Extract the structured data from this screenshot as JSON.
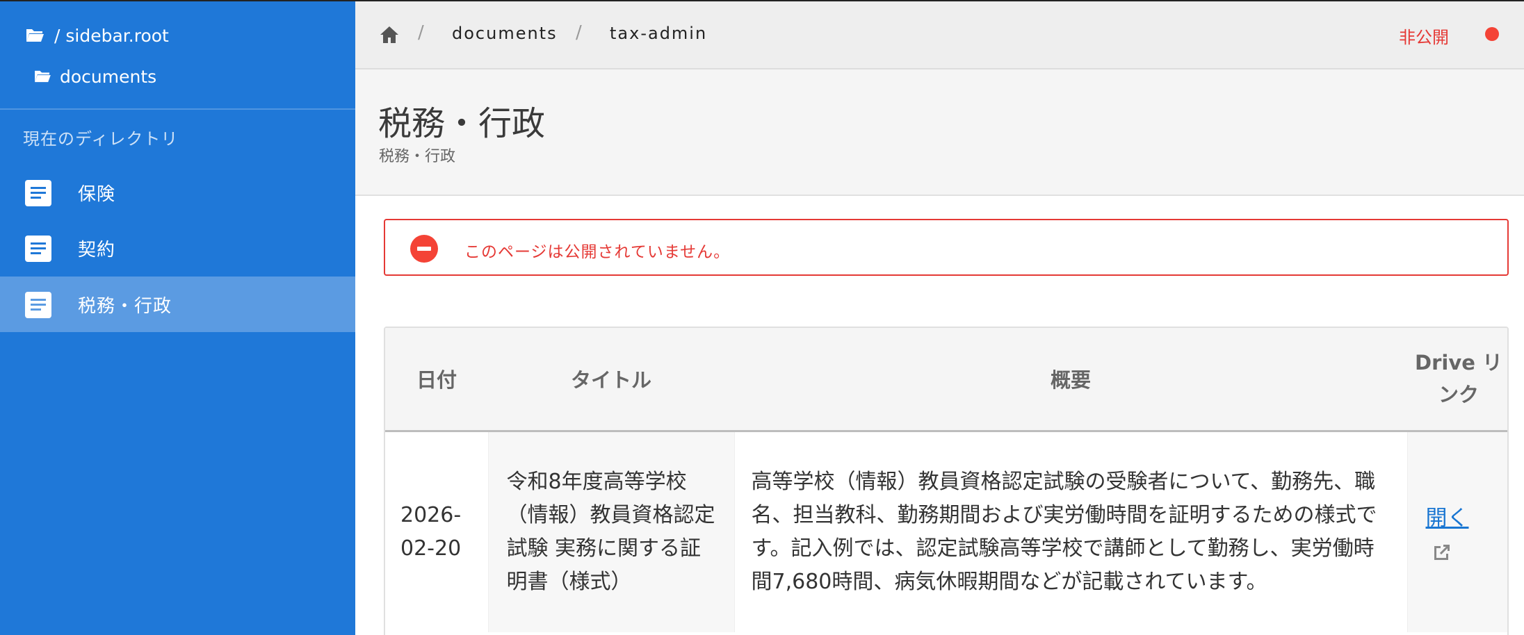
{
  "sidebar": {
    "root_label": "/ sidebar.root",
    "folder_label": "documents",
    "section_title": "現在のディレクトリ",
    "items": [
      {
        "label": "保険",
        "active": false
      },
      {
        "label": "契約",
        "active": false
      },
      {
        "label": "税務・行政",
        "active": true
      }
    ]
  },
  "topbar": {
    "breadcrumb": [
      "documents",
      "tax-admin"
    ],
    "separator": "/",
    "status_text": "非公開",
    "status_color": "#f44336"
  },
  "header": {
    "title": "税務・行政",
    "subtitle": "税務・行政"
  },
  "alert": {
    "text": "このページは公開されていません。",
    "color": "#e53935"
  },
  "table": {
    "columns": [
      "日付",
      "タイトル",
      "概要",
      "Drive リンク"
    ],
    "rows": [
      {
        "date": "2026-02-20",
        "title": "令和8年度高等学校（情報）教員資格認定試験 実務に関する証明書（様式）",
        "summary": "高等学校（情報）教員資格認定試験の受験者について、勤務先、職名、担当教科、勤務期間および実労働時間を証明するための様式です。記入例では、認定試験高等学校で講師として勤務し、実労働時間7,680時間、病気休暇期間などが記載されています。",
        "link_text": "開く"
      }
    ]
  },
  "colors": {
    "sidebar_bg": "#1f78d8",
    "sidebar_active": "#5b9be2",
    "link": "#1976d2"
  }
}
